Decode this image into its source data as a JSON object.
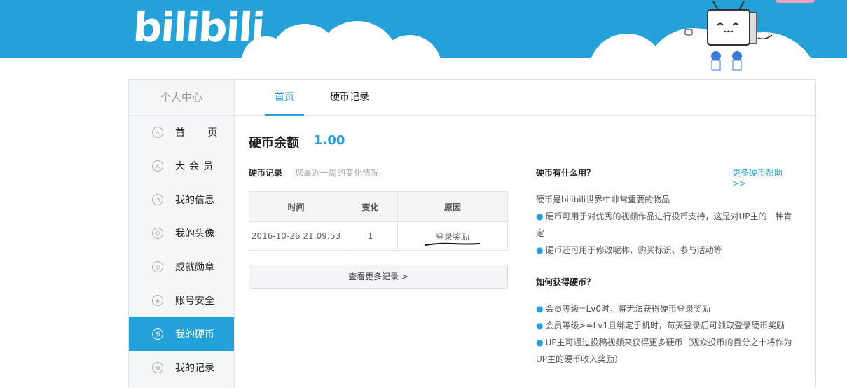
{
  "brand": {
    "logo_text": "bilibili"
  },
  "sidebar": {
    "title": "个人中心",
    "items": [
      {
        "label": "首 页",
        "icon": "home-icon",
        "glyph": "⌂"
      },
      {
        "label": "大会员",
        "icon": "vip-icon",
        "glyph": "大"
      },
      {
        "label": "我的信息",
        "icon": "user-icon",
        "glyph": "◔"
      },
      {
        "label": "我的头像",
        "icon": "avatar-icon",
        "glyph": "☺"
      },
      {
        "label": "成就勋章",
        "icon": "medal-icon",
        "glyph": "◎"
      },
      {
        "label": "账号安全",
        "icon": "shield-icon",
        "glyph": "◈"
      },
      {
        "label": "我的硬币",
        "icon": "coin-icon",
        "glyph": "币"
      },
      {
        "label": "我的记录",
        "icon": "record-icon",
        "glyph": "▤"
      }
    ]
  },
  "tabs": [
    {
      "label": "首页"
    },
    {
      "label": "硬币记录"
    }
  ],
  "balance": {
    "label": "硬币余额",
    "value": "1.00"
  },
  "records": {
    "title": "硬币记录",
    "subtitle": "您最近一周的变化情况",
    "headers": [
      "时间",
      "变化",
      "原因"
    ],
    "rows": [
      {
        "time": "2016-10-26 21:09:53",
        "change": "1",
        "reason": "登录奖励"
      }
    ],
    "more_button": "查看更多记录 >"
  },
  "info": {
    "uses_title": "硬币有什么用？",
    "help_link": "更多硬币帮助>>",
    "uses_intro": "硬币是bilibili世界中非常重要的物品",
    "uses": [
      "硬币可用于对优秀的视频作品进行投币支持，这是对UP主的一种肯定",
      "硬币还可用于修改昵称、购买标识、参与活动等"
    ],
    "get_title": "如何获得硬币？",
    "get": [
      "会员等级=Lv0时，将无法获得硬币登录奖励",
      "会员等级>=Lv1且绑定手机时，每天登录后可领取登录硬币奖励",
      "UP主可通过投稿视频来获得更多硬币（观众投币的百分之十将作为UP主的硬币收入奖励）"
    ]
  },
  "colors": {
    "accent": "#23a1d8",
    "banner": "#23a1d8"
  }
}
